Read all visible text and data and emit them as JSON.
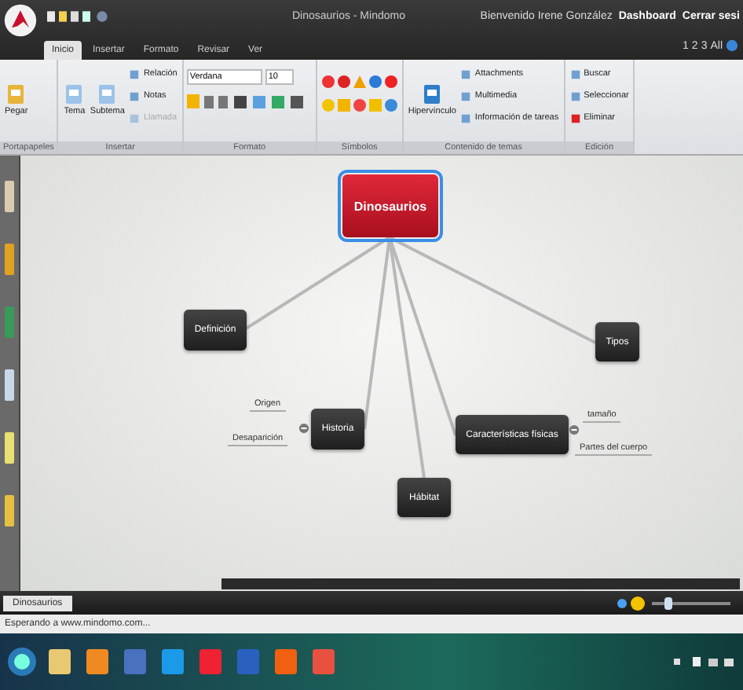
{
  "window": {
    "title": "Dinosaurios - Mindomo"
  },
  "user": {
    "greeting": "Bienvenido Irene González",
    "links": [
      "Dashboard",
      "Cerrar sesi"
    ]
  },
  "views": [
    "1",
    "2",
    "3",
    "All"
  ],
  "tabs": [
    {
      "label": "Inicio",
      "selected": true
    },
    {
      "label": "Insertar",
      "selected": false
    },
    {
      "label": "Formato",
      "selected": false
    },
    {
      "label": "Revisar",
      "selected": false
    },
    {
      "label": "Ver",
      "selected": false
    }
  ],
  "ribbon": [
    {
      "kind": "buttons",
      "label": "Portapapeles",
      "items": [
        {
          "kind": "large",
          "label": "Pegar",
          "disabled": false
        }
      ]
    },
    {
      "kind": "buttons",
      "label": "Insertar",
      "items": [
        {
          "kind": "large",
          "label": "Tema",
          "disabled": false
        },
        {
          "kind": "large",
          "label": "Subtema",
          "disabled": false
        },
        {
          "kind": "small",
          "label": "Relación",
          "disabled": false
        },
        {
          "kind": "small",
          "label": "Notas",
          "disabled": false
        },
        {
          "kind": "small",
          "label": "Llamada",
          "disabled": true
        }
      ]
    },
    {
      "kind": "font",
      "label": "Formato",
      "font": "Verdana",
      "size": "10"
    },
    {
      "kind": "symbols",
      "label": "Símbolos"
    },
    {
      "kind": "buttons",
      "label": "Contenido de temas",
      "items": [
        {
          "kind": "large",
          "label": "Hipervínculo",
          "disabled": false
        },
        {
          "kind": "small",
          "label": "Attachments",
          "disabled": false
        },
        {
          "kind": "small",
          "label": "Multimedia",
          "disabled": false
        },
        {
          "kind": "small",
          "label": "Información de tareas",
          "disabled": false
        }
      ]
    },
    {
      "kind": "buttons",
      "label": "Edición",
      "items": [
        {
          "kind": "small",
          "label": "Buscar",
          "disabled": false
        },
        {
          "kind": "small",
          "label": "Seleccionar",
          "disabled": false
        },
        {
          "kind": "small",
          "label": "Eliminar",
          "disabled": false
        }
      ]
    }
  ],
  "map": {
    "central": {
      "text": "Dinosaurios",
      "selected": true
    },
    "topics": [
      {
        "text": "Definición"
      },
      {
        "text": "Historia",
        "children": [
          {
            "text": "Origen"
          },
          {
            "text": "Desaparición"
          }
        ]
      },
      {
        "text": "Hábitat"
      },
      {
        "text": "Características físicas",
        "children": [
          {
            "text": "tamaño"
          },
          {
            "text": "Partes del cuerpo"
          }
        ]
      },
      {
        "text": "Tipos"
      }
    ]
  },
  "document_tabs": [
    {
      "label": "Dinosaurios",
      "selected": true
    }
  ],
  "zoom": {
    "level": 0.15
  },
  "status_bar": {
    "text": "Esperando a www.mindomo.com..."
  }
}
